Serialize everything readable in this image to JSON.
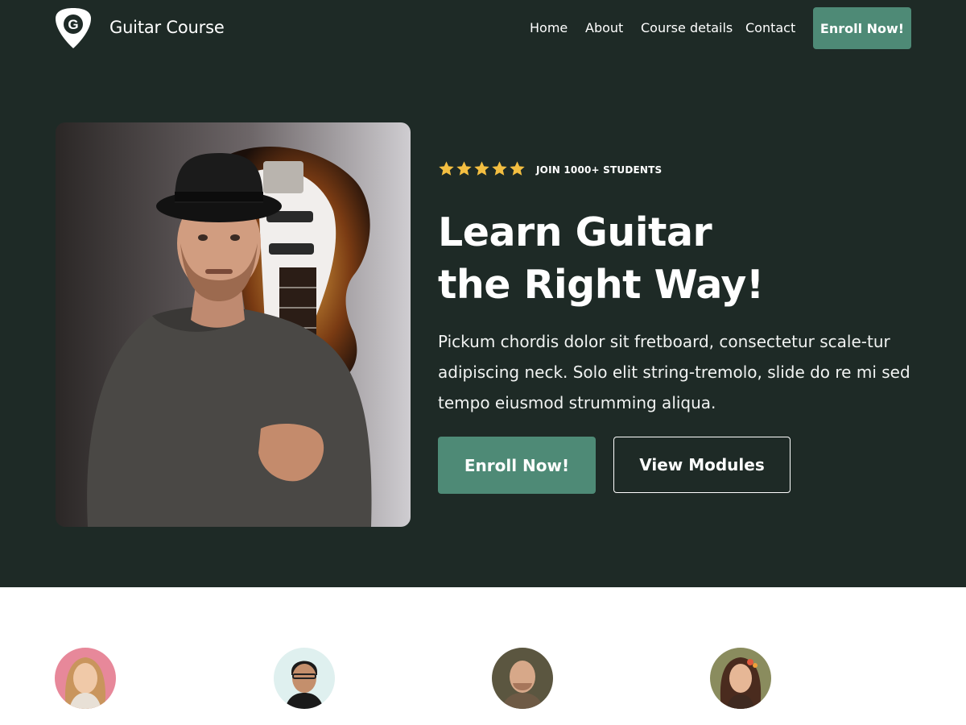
{
  "header": {
    "brand": "Guitar Course",
    "logo_letter": "G",
    "logo_icon": "guitar-pick-icon",
    "nav": [
      {
        "label": "Home"
      },
      {
        "label": "About"
      },
      {
        "label": "Course details"
      },
      {
        "label": "Contact"
      }
    ],
    "cta_label": "Enroll Now!"
  },
  "hero": {
    "rating_stars": 5,
    "rating_max": 5,
    "rating_text": "JOIN 1000+ STUDENTS",
    "headline_line1": "Learn Guitar",
    "headline_line2": "the Right Way!",
    "description": "Pickum chordis dolor sit fretboard, consectetur scale-tur adipiscing neck. Solo elit string-tremolo, slide do re mi sed tempo eiusmod strumming aliqua.",
    "primary_button": "Enroll Now!",
    "secondary_button": "View Modules"
  },
  "colors": {
    "hero_background": "#1e2a26",
    "accent": "#4e8a76",
    "star": "#f3be41",
    "text": "#ffffff"
  }
}
